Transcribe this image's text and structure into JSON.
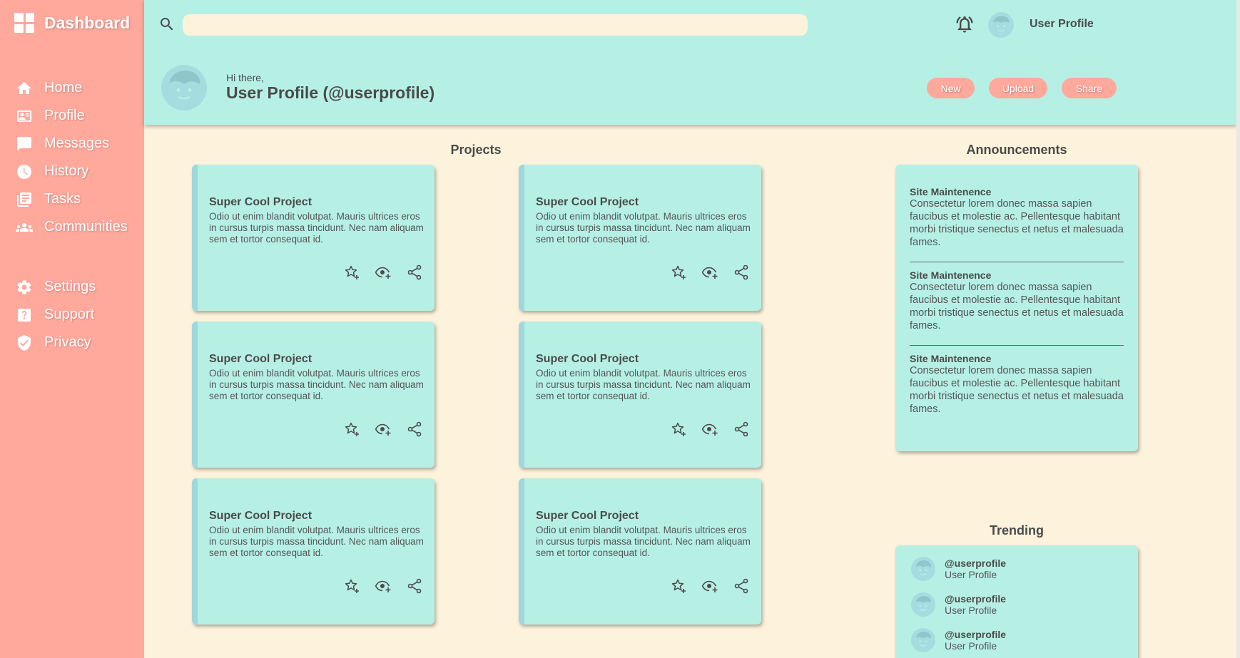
{
  "brand": {
    "title": "Dashboard"
  },
  "sidebar": {
    "primary": [
      {
        "label": "Home",
        "icon": "home-icon"
      },
      {
        "label": "Profile",
        "icon": "profile-card-icon"
      },
      {
        "label": "Messages",
        "icon": "message-icon"
      },
      {
        "label": "History",
        "icon": "clock-icon"
      },
      {
        "label": "Tasks",
        "icon": "tasks-icon"
      },
      {
        "label": "Communities",
        "icon": "people-icon"
      }
    ],
    "secondary": [
      {
        "label": "Settings",
        "icon": "gear-icon"
      },
      {
        "label": "Support",
        "icon": "help-icon"
      },
      {
        "label": "Privacy",
        "icon": "shield-icon"
      }
    ]
  },
  "header": {
    "search": {
      "value": "",
      "placeholder": ""
    },
    "user_label": "User Profile",
    "greeting": "Hi there,",
    "profile_name": "User Profile (@userprofile)",
    "buttons": {
      "new": "New",
      "upload": "Upload",
      "share": "Share"
    }
  },
  "projects": {
    "title": "Projects",
    "items": [
      {
        "title": "Super Cool Project",
        "desc": "Odio ut enim blandit volutpat. Mauris ultrices eros in cursus turpis massa tincidunt. Nec nam aliquam sem et tortor consequat id."
      },
      {
        "title": "Super Cool Project",
        "desc": "Odio ut enim blandit volutpat. Mauris ultrices eros in cursus turpis massa tincidunt. Nec nam aliquam sem et tortor consequat id."
      },
      {
        "title": "Super Cool Project",
        "desc": "Odio ut enim blandit volutpat. Mauris ultrices eros in cursus turpis massa tincidunt. Nec nam aliquam sem et tortor consequat id."
      },
      {
        "title": "Super Cool Project",
        "desc": "Odio ut enim blandit volutpat. Mauris ultrices eros in cursus turpis massa tincidunt. Nec nam aliquam sem et tortor consequat id."
      },
      {
        "title": "Super Cool Project",
        "desc": "Odio ut enim blandit volutpat. Mauris ultrices eros in cursus turpis massa tincidunt. Nec nam aliquam sem et tortor consequat id."
      },
      {
        "title": "Super Cool Project",
        "desc": "Odio ut enim blandit volutpat. Mauris ultrices eros in cursus turpis massa tincidunt. Nec nam aliquam sem et tortor consequat id."
      }
    ]
  },
  "announcements": {
    "title": "Announcements",
    "items": [
      {
        "title": "Site Maintenence",
        "text": "Consectetur lorem donec massa sapien faucibus et molestie ac. Pellentesque habitant morbi tristique senectus et netus et malesuada fames."
      },
      {
        "title": "Site Maintenence",
        "text": "Consectetur lorem donec massa sapien faucibus et molestie ac. Pellentesque habitant morbi tristique senectus et netus et malesuada fames."
      },
      {
        "title": "Site Maintenence",
        "text": "Consectetur lorem donec massa sapien faucibus et molestie ac. Pellentesque habitant morbi tristique senectus et netus et malesuada fames."
      }
    ]
  },
  "trending": {
    "title": "Trending",
    "items": [
      {
        "handle": "@userprofile",
        "name": "User Profile"
      },
      {
        "handle": "@userprofile",
        "name": "User Profile"
      },
      {
        "handle": "@userprofile",
        "name": "User Profile"
      }
    ]
  },
  "colors": {
    "sidebar": "#ffa89c",
    "header": "#b6f0e5",
    "background": "#fdf3dc",
    "text": "#4a4a4a"
  }
}
